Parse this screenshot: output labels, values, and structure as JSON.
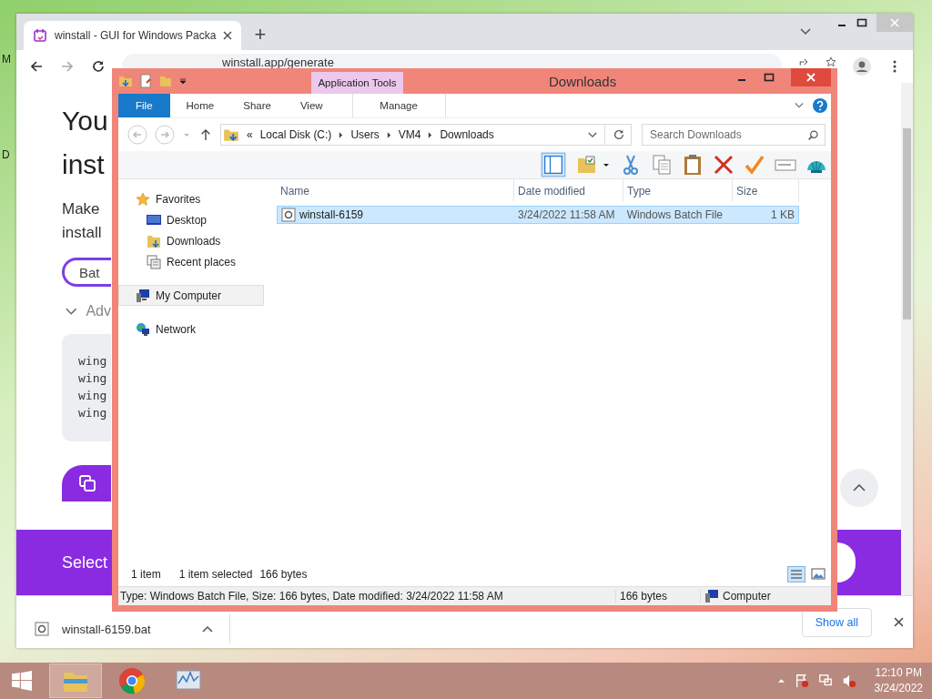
{
  "desktop": {
    "icon_labels": [
      "M",
      "D"
    ]
  },
  "browser": {
    "tab": {
      "title": "winstall - GUI for Windows Packa",
      "selected": true
    },
    "new_tab": "+",
    "address": "winstall.app/generate",
    "page": {
      "heading_lines": [
        "You",
        "inst"
      ],
      "text_lines": [
        "Make",
        "install"
      ],
      "format_button": "Bat",
      "advanced": "Adv",
      "code_lines": [
        "wing",
        "wing",
        "wing",
        "wing"
      ],
      "banner": "Select"
    },
    "download": {
      "file": "winstall-6159.bat",
      "show_all": "Show all"
    }
  },
  "explorer": {
    "title": "Downloads",
    "context_tab": "Application Tools",
    "ribbon_tabs": [
      {
        "label": "File",
        "selected": true
      },
      {
        "label": "Home",
        "selected": false
      },
      {
        "label": "Share",
        "selected": false
      },
      {
        "label": "View",
        "selected": false
      },
      {
        "label": "Manage",
        "selected": false
      }
    ],
    "overflow_mark": "«",
    "breadcrumb": [
      "Local Disk (C:)",
      "Users",
      "VM4",
      "Downloads"
    ],
    "search": {
      "placeholder": "Search Downloads"
    },
    "nav": [
      {
        "label": "Favorites",
        "kind": "star",
        "selected": false,
        "children": [
          {
            "label": "Desktop",
            "kind": "desktop",
            "selected": false
          },
          {
            "label": "Downloads",
            "kind": "folder",
            "selected": false
          },
          {
            "label": "Recent places",
            "kind": "recent",
            "selected": false
          }
        ]
      },
      {
        "label": "My Computer",
        "kind": "computer",
        "selected": true
      },
      {
        "label": "Network",
        "kind": "network",
        "selected": false
      }
    ],
    "columns": [
      "Name",
      "Date modified",
      "Type",
      "Size"
    ],
    "files": [
      {
        "name": "winstall-6159",
        "date": "3/24/2022 11:58 AM",
        "type": "Windows Batch File",
        "size": "1 KB",
        "selected": true
      }
    ],
    "status": {
      "count": "1 item",
      "selection": "1 item selected",
      "size": "166 bytes"
    },
    "details_bar": {
      "info": "Type: Windows Batch File, Size: 166 bytes, Date modified: 3/24/2022 11:58 AM",
      "size": "166 bytes",
      "location": "Computer"
    }
  },
  "taskbar": {
    "apps": [
      {
        "kind": "explorer",
        "selected": true
      },
      {
        "kind": "chrome",
        "selected": false
      },
      {
        "kind": "monitor",
        "selected": false
      }
    ],
    "time": "12:10 PM",
    "date": "3/24/2022"
  }
}
